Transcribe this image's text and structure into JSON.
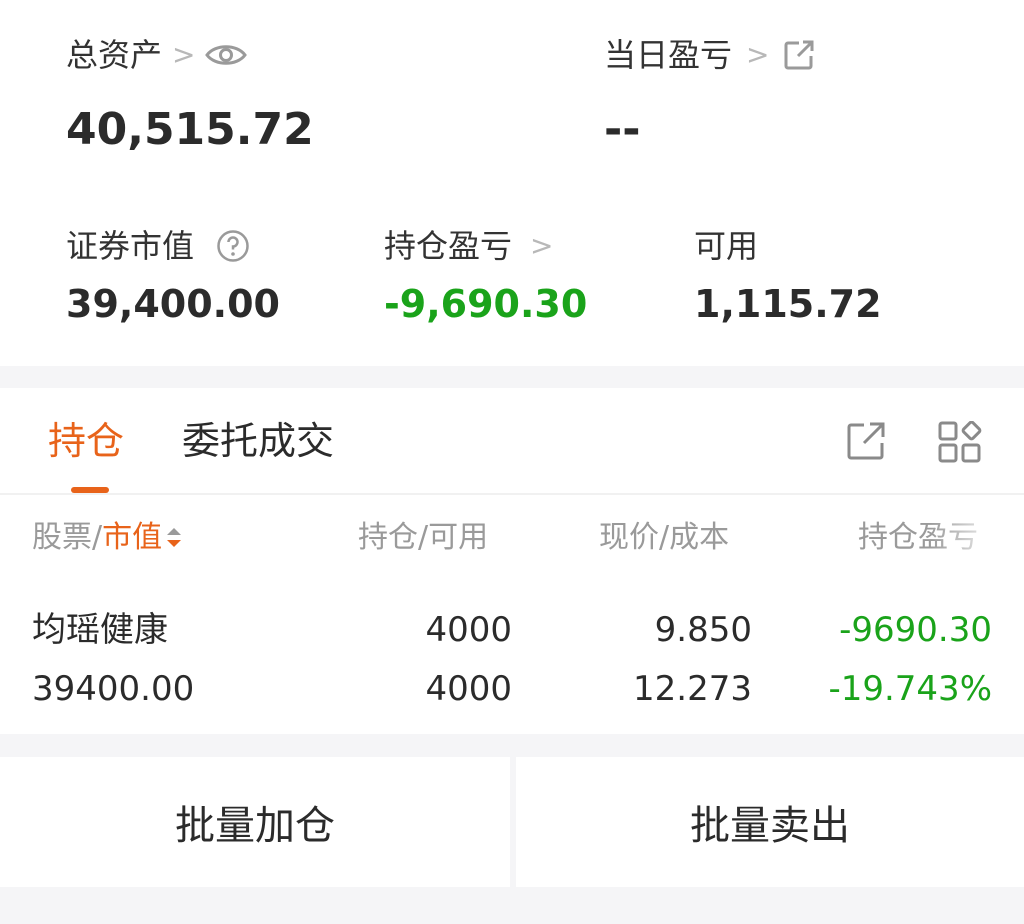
{
  "summary": {
    "total_assets_label": "总资产",
    "total_assets_value": "40,515.72",
    "daily_pnl_label": "当日盈亏",
    "daily_pnl_value": "--",
    "securities_value_label": "证券市值",
    "securities_value": "39,400.00",
    "position_pnl_label": "持仓盈亏",
    "position_pnl_value": "-9,690.30",
    "available_label": "可用",
    "available_value": "1,115.72"
  },
  "tabs": {
    "holdings": "持仓",
    "orders": "委托成交"
  },
  "table": {
    "headers": {
      "stock": "股票",
      "market_value": "市值",
      "position": "持仓",
      "available": "可用",
      "current_price": "现价",
      "cost": "成本",
      "position_pnl": "持仓盈亏"
    },
    "rows": [
      {
        "name": "均瑶健康",
        "market_value": "39400.00",
        "position": "4000",
        "available": "4000",
        "current_price": "9.850",
        "cost": "12.273",
        "pnl": "-9690.30",
        "pnl_pct": "-19.743%"
      }
    ]
  },
  "actions": {
    "batch_add": "批量加仓",
    "batch_sell": "批量卖出"
  },
  "colors": {
    "accent": "#e8631a",
    "gain_loss_green": "#1aa31a",
    "background": "#f5f5f7"
  },
  "icons": [
    "eye-icon",
    "share-icon",
    "question-icon",
    "chevron-right-icon",
    "export-icon",
    "grid-icon",
    "sort-icon"
  ]
}
